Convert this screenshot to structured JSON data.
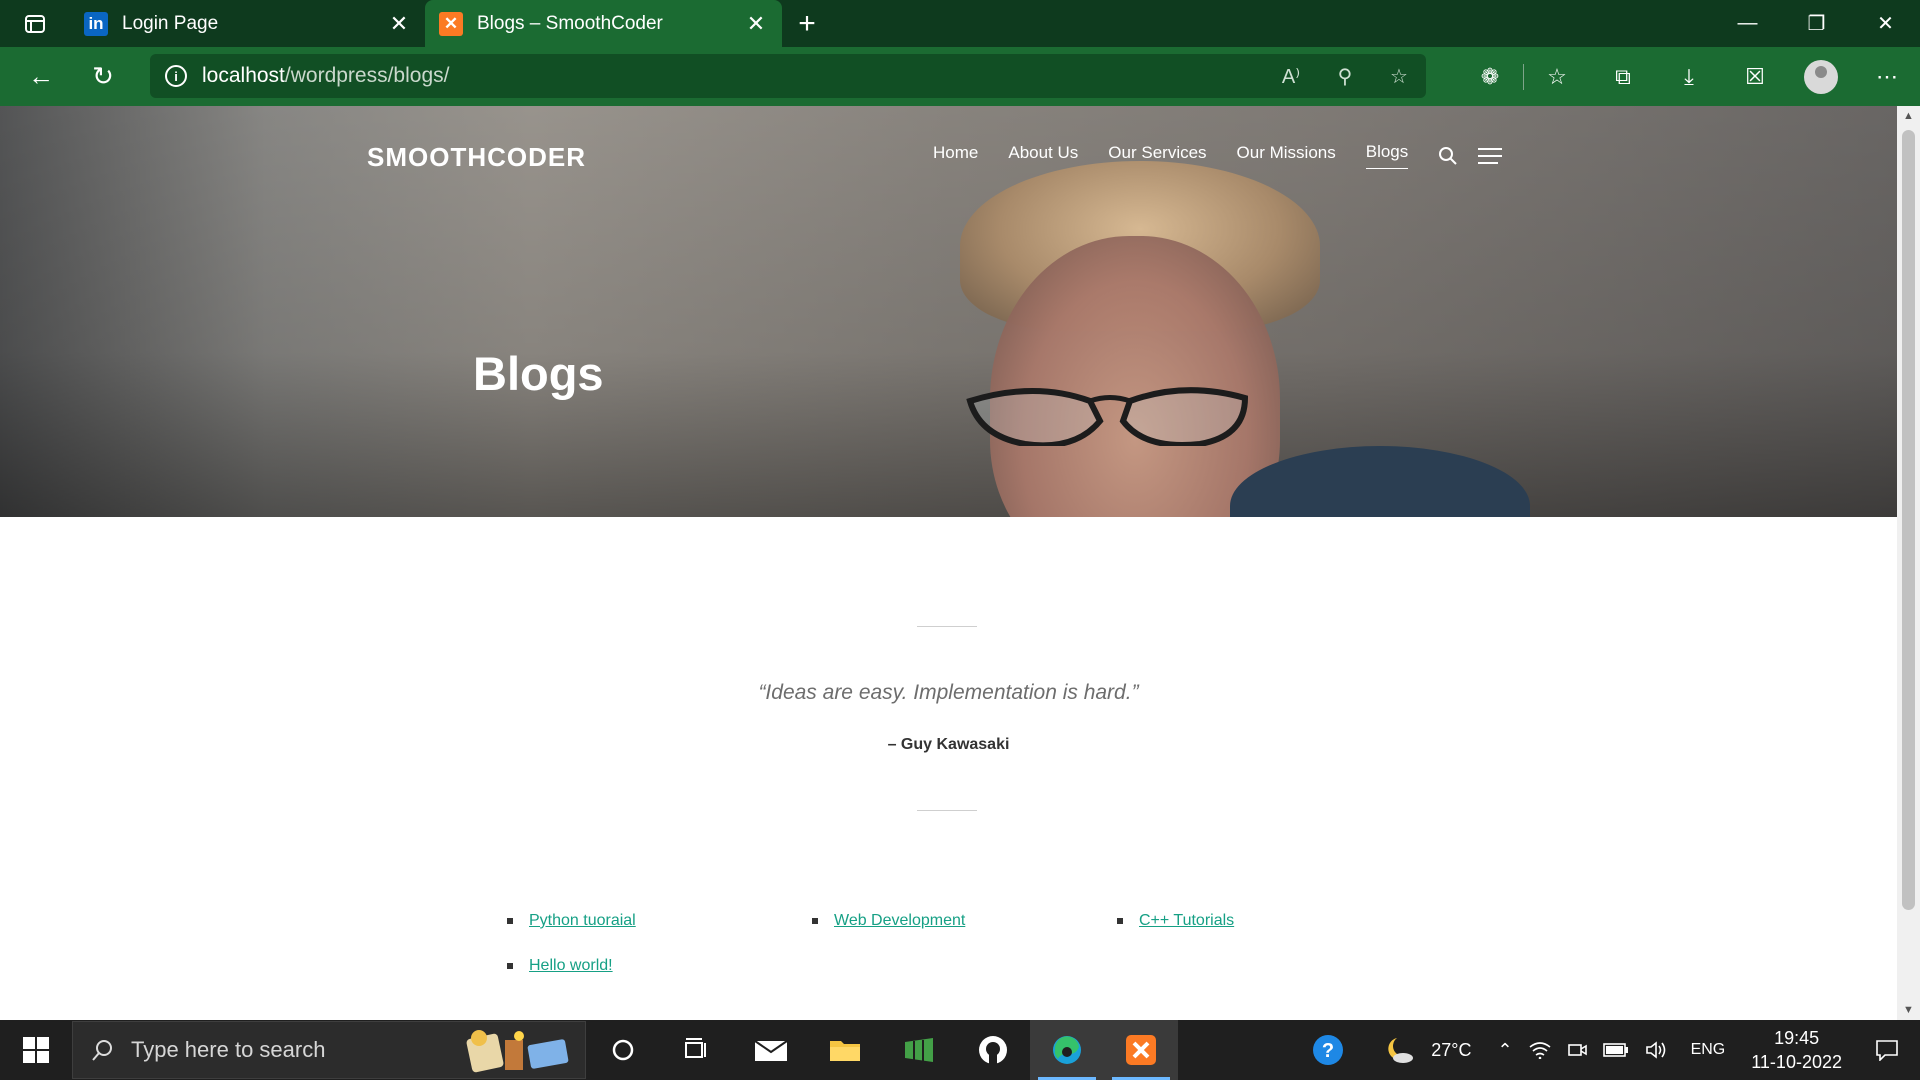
{
  "browser": {
    "tabs": [
      {
        "title": "Login Page",
        "favicon": "in",
        "favicon_color": "#0a66c2",
        "active": false
      },
      {
        "title": "Blogs – SmoothCoder",
        "favicon": "✕",
        "favicon_color": "#fb7a24",
        "active": true
      }
    ],
    "address": {
      "host": "localhost",
      "path": "/wordpress/blogs/"
    }
  },
  "site": {
    "title": "SMOOTHCODER",
    "nav": [
      "Home",
      "About Us",
      "Our Services",
      "Our Missions",
      "Blogs"
    ],
    "current_nav": "Blogs",
    "page_title": "Blogs"
  },
  "content": {
    "quote": "“Ideas are easy. Implementation is hard.”",
    "cite": "– Guy Kawasaki",
    "posts": [
      "Python tuoraial",
      "Web Development",
      "C++ Tutorials",
      "Hello world!"
    ],
    "link_color": "#16a085"
  },
  "taskbar": {
    "search_placeholder": "Type here to search",
    "weather": "27°C",
    "language": "ENG",
    "time": "19:45",
    "date": "11-10-2022"
  },
  "colors": {
    "tab_bar": "#0e3a1e",
    "toolbar": "#1b6b32"
  }
}
